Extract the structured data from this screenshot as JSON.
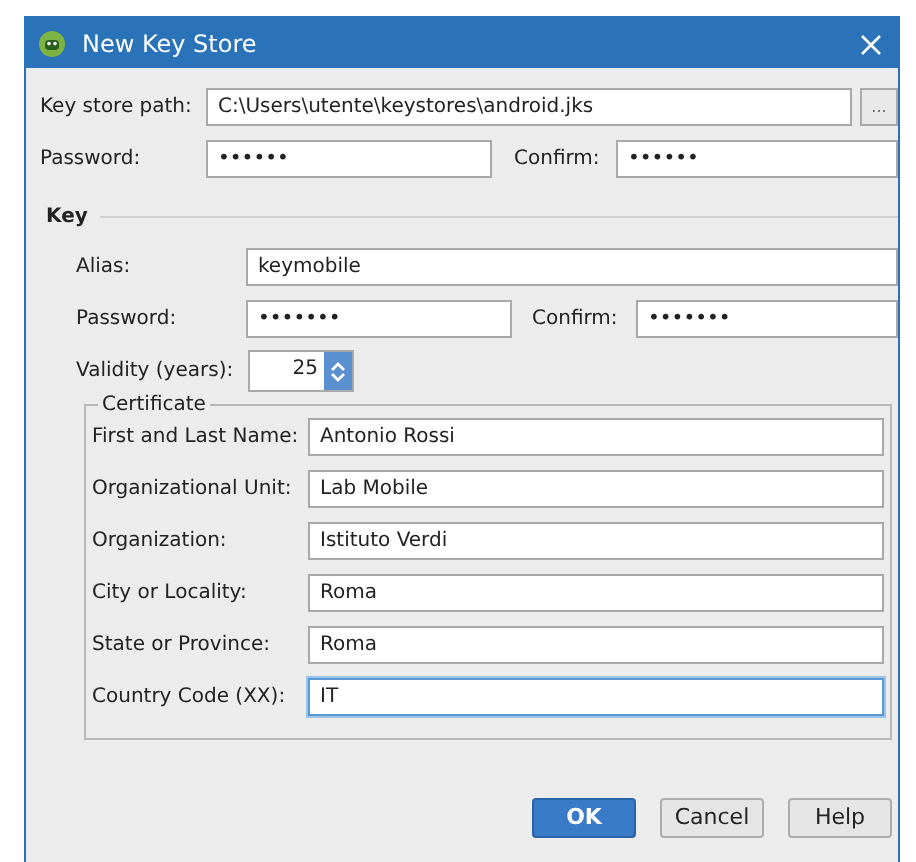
{
  "window": {
    "title": "New Key Store"
  },
  "keystore": {
    "path_label": "Key store path:",
    "path": "C:\\Users\\utente\\keystores\\android.jks",
    "browse": "...",
    "password_label": "Password:",
    "password": "••••••",
    "confirm_label": "Confirm:",
    "confirm": "••••••"
  },
  "key": {
    "title": "Key",
    "alias_label": "Alias:",
    "alias": "keymobile",
    "password_label": "Password:",
    "password": "•••••••",
    "confirm_label": "Confirm:",
    "confirm": "•••••••",
    "validity_label": "Validity (years):",
    "validity": "25"
  },
  "certificate": {
    "title": "Certificate",
    "fields": [
      {
        "label": "First and Last Name:",
        "value": "Antonio Rossi",
        "focused": false
      },
      {
        "label": "Organizational Unit:",
        "value": "Lab Mobile",
        "focused": false
      },
      {
        "label": "Organization:",
        "value": "Istituto Verdi",
        "focused": false
      },
      {
        "label": "City or Locality:",
        "value": "Roma",
        "focused": false
      },
      {
        "label": "State or Province:",
        "value": "Roma",
        "focused": false
      },
      {
        "label": "Country Code (XX):",
        "value": "IT",
        "focused": true
      }
    ]
  },
  "buttons": [
    {
      "label": "OK",
      "kind": "primary"
    },
    {
      "label": "Cancel",
      "kind": "normal"
    },
    {
      "label": "Help",
      "kind": "normal"
    }
  ]
}
